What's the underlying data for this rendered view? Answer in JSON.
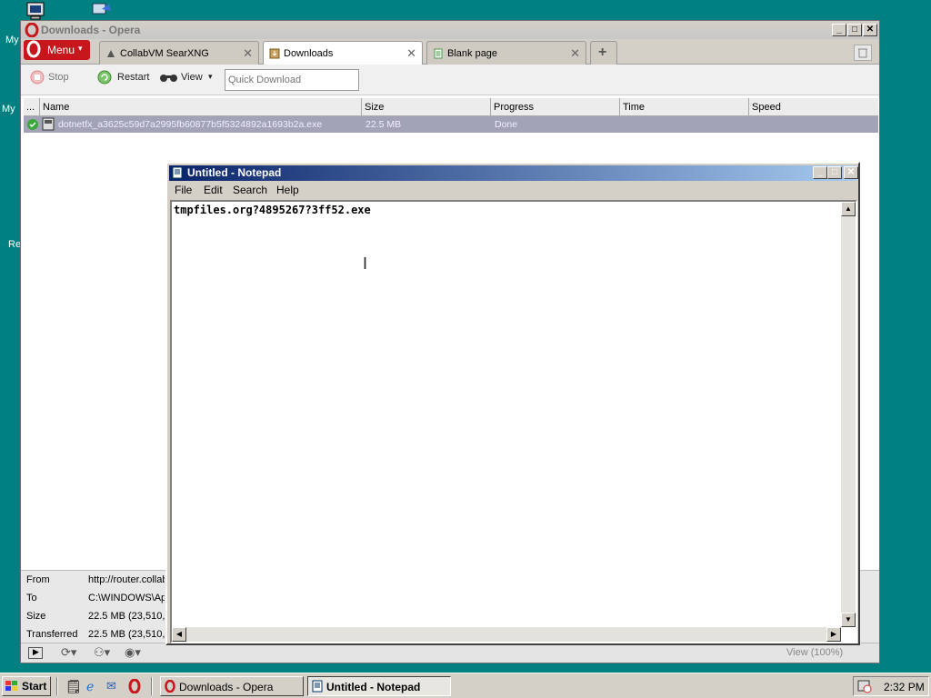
{
  "desktop": {
    "icon_labels": [
      "My",
      "My",
      "Re"
    ]
  },
  "opera": {
    "title": "Downloads - Opera",
    "menu_label": "Menu",
    "tabs": [
      {
        "label": "CollabVM SearXNG",
        "close": "✕"
      },
      {
        "label": "Downloads",
        "close": "✕"
      },
      {
        "label": "Blank page",
        "close": "✕"
      }
    ],
    "new_tab": "+",
    "toolbar": {
      "stop": "Stop",
      "restart": "Restart",
      "view": "View",
      "quick_download_placeholder": "Quick Download"
    },
    "columns": [
      "...",
      "Name",
      "Size",
      "Progress",
      "Time",
      "Speed"
    ],
    "downloads": [
      {
        "name": "dotnetfx_a3625c59d7a2995fb60877b5f5324892a1693b2a.exe",
        "size": "22.5 MB",
        "progress": "Done",
        "time": "",
        "speed": ""
      }
    ],
    "details": {
      "from_label": "From",
      "from_value": "http://router.collab",
      "to_label": "To",
      "to_value": "C:\\WINDOWS\\Ap",
      "size_label": "Size",
      "size_value": "22.5 MB (23,510,",
      "transferred_label": "Transferred",
      "transferred_value": "22.5 MB (23,510,"
    },
    "status": {
      "zoom": "View (100%)"
    }
  },
  "notepad": {
    "title": "Untitled - Notepad",
    "menus": [
      "File",
      "Edit",
      "Search",
      "Help"
    ],
    "content": "tmpfiles.org?4895267?3ff52.exe"
  },
  "taskbar": {
    "start": "Start",
    "tasks": [
      {
        "label": "Downloads - Opera",
        "active": false
      },
      {
        "label": "Untitled - Notepad",
        "active": true
      }
    ],
    "clock": "2:32 PM"
  },
  "colors": {
    "desktop": "#008080",
    "opera_red": "#c8161d",
    "notepad_title_start": "#0a246a",
    "notepad_title_end": "#a6caf0",
    "selected_row": "#a3a3b8"
  }
}
